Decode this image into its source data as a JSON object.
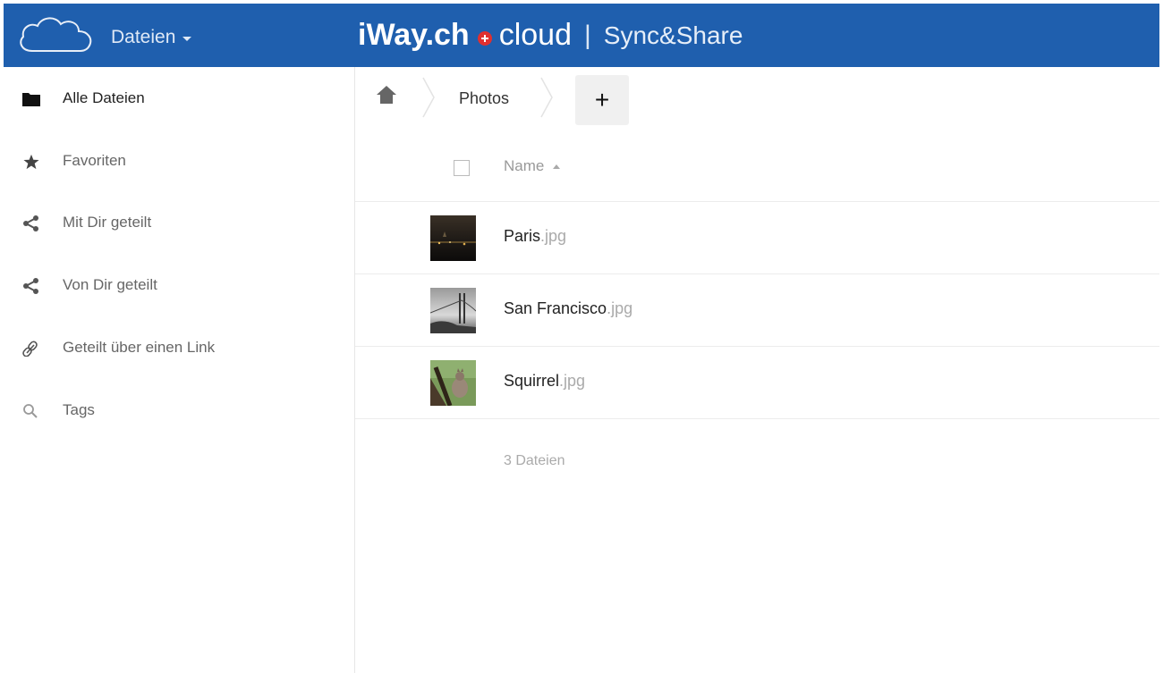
{
  "header": {
    "app_menu_label": "Dateien",
    "brand_main": "iWay.ch",
    "brand_cloud": "cloud",
    "brand_separator": "|",
    "brand_sub": "Sync&Share",
    "background_color": "#1f5fae"
  },
  "sidebar": {
    "items": [
      {
        "label": "Alle Dateien",
        "icon": "folder-icon",
        "active": true
      },
      {
        "label": "Favoriten",
        "icon": "star-icon"
      },
      {
        "label": "Mit Dir geteilt",
        "icon": "share-icon"
      },
      {
        "label": "Von Dir geteilt",
        "icon": "share-icon"
      },
      {
        "label": "Geteilt über einen Link",
        "icon": "link-icon"
      },
      {
        "label": "Tags",
        "icon": "search-icon"
      }
    ]
  },
  "breadcrumb": {
    "home_icon": "home-icon",
    "items": [
      "Photos"
    ],
    "new_button_label": "+"
  },
  "file_list": {
    "column_name": "Name",
    "files": [
      {
        "name": "Paris",
        "ext": ".jpg"
      },
      {
        "name": "San Francisco",
        "ext": ".jpg"
      },
      {
        "name": "Squirrel",
        "ext": ".jpg"
      }
    ],
    "summary": "3 Dateien"
  }
}
